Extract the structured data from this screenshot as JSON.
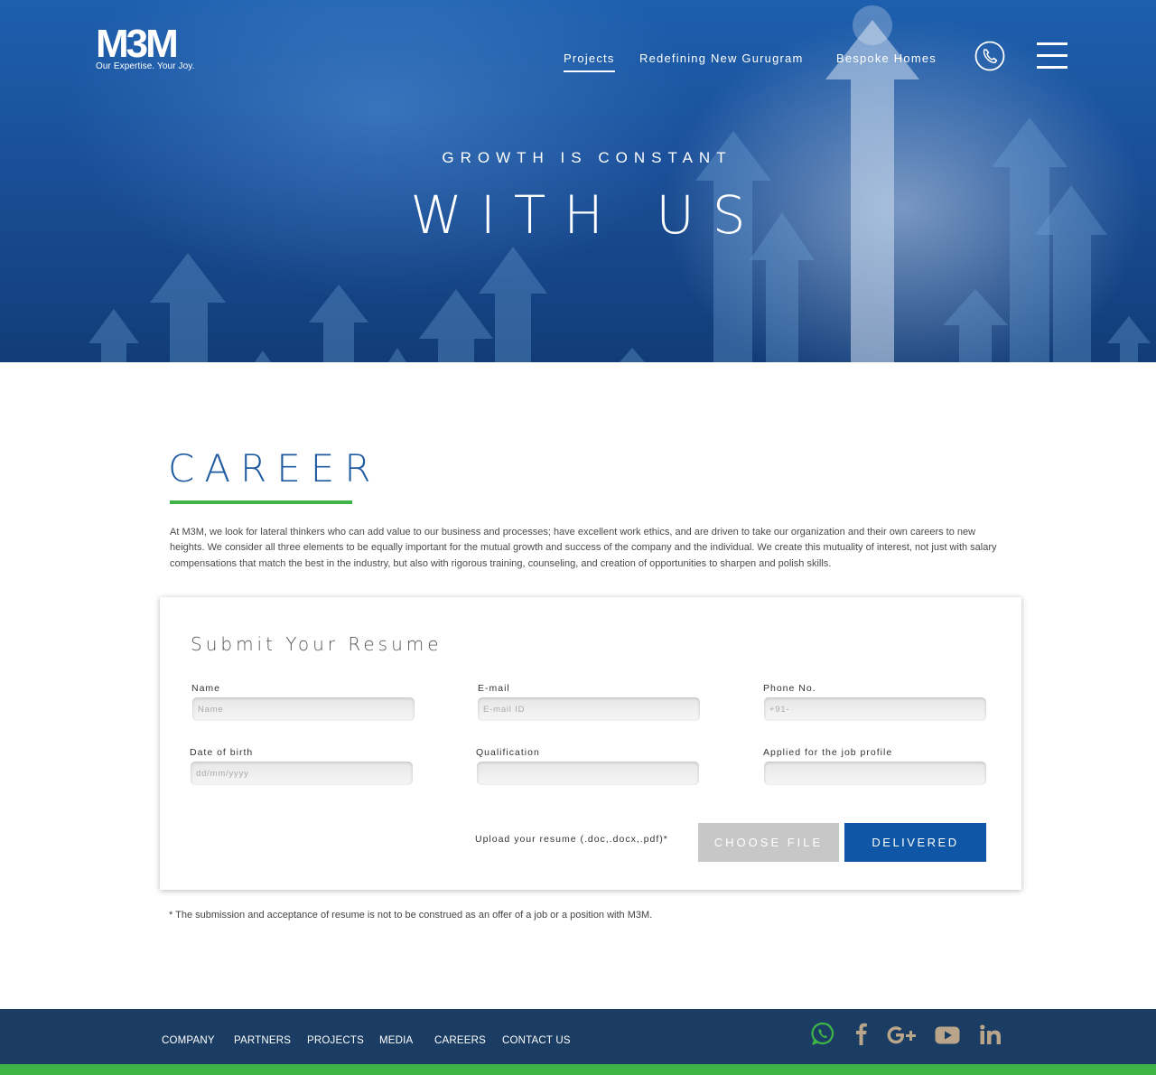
{
  "brand": {
    "logo_text": "M3M",
    "tagline": "Our Expertise. Your Joy."
  },
  "nav": {
    "items": [
      {
        "label": "Projects",
        "active": true
      },
      {
        "label": "Redefining New Gurugram",
        "active": false
      },
      {
        "label": "Bespoke Homes",
        "active": false
      }
    ],
    "phone_icon": "phone-icon",
    "menu_icon": "hamburger-menu-icon"
  },
  "hero": {
    "subtitle": "GROWTH IS CONSTANT",
    "title": "WITH US"
  },
  "career": {
    "heading": "CAREER",
    "intro": "At M3M, we look for lateral thinkers who can add value to our business and processes; have excellent work ethics, and are driven to take our organization and their own careers to new heights. We consider all three elements to be equally important for the mutual growth and success of the company and the individual. We create this mutuality of interest, not just with salary compensations that match the best in the industry, but also with rigorous training, counseling, and creation of opportunities to sharpen and polish skills."
  },
  "form": {
    "title": "Submit Your Resume",
    "fields": [
      {
        "label": "Name",
        "placeholder": "Name",
        "value": ""
      },
      {
        "label": "E-mail",
        "placeholder": "E-mail ID",
        "value": ""
      },
      {
        "label": "Phone No.",
        "placeholder": "+91-",
        "value": ""
      },
      {
        "label": "Date of birth",
        "placeholder": "dd/mm/yyyy",
        "value": ""
      },
      {
        "label": "Qualification",
        "placeholder": "",
        "value": ""
      },
      {
        "label": "Applied for the job profile",
        "placeholder": "",
        "value": ""
      }
    ],
    "upload_label": "Upload your resume (.doc,.docx,.pdf)*",
    "choose_file": "CHOOSE FILE",
    "submit": "DELIVERED"
  },
  "disclaimer": "* The submission and acceptance of resume is not to be construed as an offer of a job or a position with M3M.",
  "footer": {
    "links": [
      "COMPANY",
      "PARTNERS",
      "PROJECTS",
      "MEDIA",
      "CAREERS",
      "CONTACT US"
    ],
    "social_icons": [
      "whatsapp-icon",
      "facebook-icon",
      "google-plus-icon",
      "youtube-icon",
      "linkedin-icon"
    ]
  },
  "colors": {
    "brand_blue": "#1e5aa0",
    "accent_green": "#3fb548",
    "footer_bg": "#1b3d63",
    "submit_bg": "#0f56a6",
    "choose_bg": "#c7c7c7",
    "social_icon": "#b9a68a",
    "whatsapp": "#3fb548"
  }
}
